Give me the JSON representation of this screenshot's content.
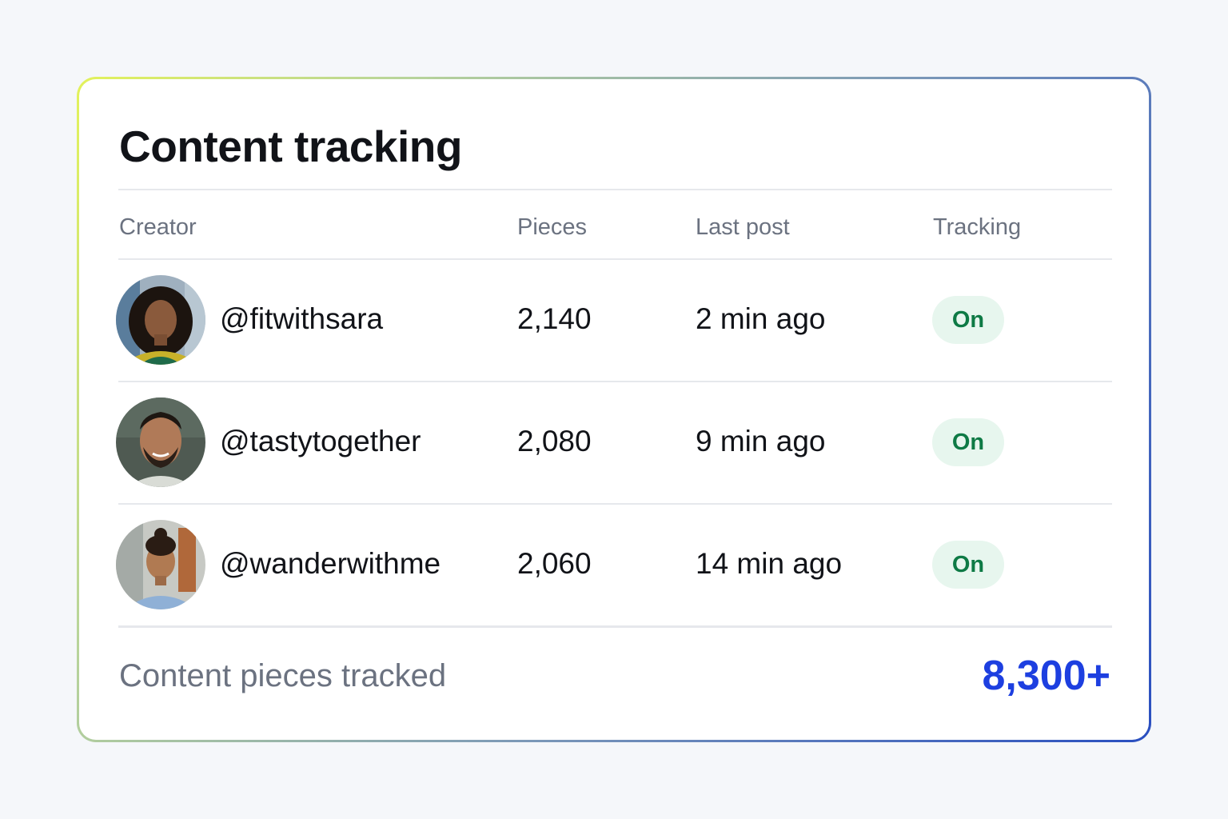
{
  "card": {
    "title": "Content tracking"
  },
  "table": {
    "columns": [
      "Creator",
      "Pieces",
      "Last post",
      "Tracking"
    ],
    "rows": [
      {
        "creator": "@fitwithsara",
        "pieces": "2,140",
        "last_post": "2 min ago",
        "tracking": "On"
      },
      {
        "creator": "@tastytogether",
        "pieces": "2,080",
        "last_post": "9 min ago",
        "tracking": "On"
      },
      {
        "creator": "@wanderwithme",
        "pieces": "2,060",
        "last_post": "14 min ago",
        "tracking": "On"
      }
    ]
  },
  "footer": {
    "label": "Content pieces tracked",
    "value": "8,300+"
  },
  "colors": {
    "accent": "#1d3fe0",
    "status_on_text": "#0e7a45",
    "status_on_bg": "#e7f6ee"
  }
}
